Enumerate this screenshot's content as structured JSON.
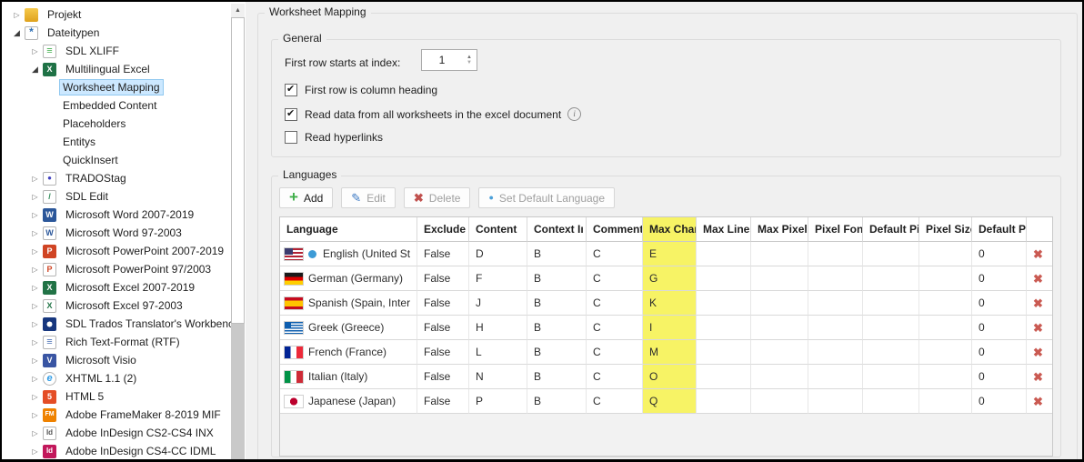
{
  "sidebar": {
    "items": [
      {
        "label": "Projekt",
        "level": 0,
        "arrow": "collapsed",
        "icon": "project",
        "icon_text": "",
        "selected": false
      },
      {
        "label": "Dateitypen",
        "level": 0,
        "arrow": "expanded",
        "icon": "filetypes",
        "icon_text": "*",
        "selected": false
      },
      {
        "label": "SDL XLIFF",
        "level": 1,
        "arrow": "collapsed",
        "icon": "sdlxliff",
        "icon_text": "≡",
        "selected": false
      },
      {
        "label": "Multilingual Excel",
        "level": 1,
        "arrow": "expanded",
        "icon": "mlexcel",
        "icon_text": "X",
        "selected": false
      },
      {
        "label": "Worksheet Mapping",
        "level": 2,
        "arrow": "none",
        "icon": null,
        "selected": true
      },
      {
        "label": "Embedded Content",
        "level": 2,
        "arrow": "none",
        "icon": null,
        "selected": false
      },
      {
        "label": "Placeholders",
        "level": 2,
        "arrow": "none",
        "icon": null,
        "selected": false
      },
      {
        "label": "Entitys",
        "level": 2,
        "arrow": "none",
        "icon": null,
        "selected": false
      },
      {
        "label": "QuickInsert",
        "level": 2,
        "arrow": "none",
        "icon": null,
        "selected": false
      },
      {
        "label": "TRADOStag",
        "level": 1,
        "arrow": "collapsed",
        "icon": "tradostag",
        "icon_text": "●",
        "selected": false
      },
      {
        "label": "SDL Edit",
        "level": 1,
        "arrow": "collapsed",
        "icon": "sdledit",
        "icon_text": "/",
        "selected": false
      },
      {
        "label": "Microsoft Word 2007-2019",
        "level": 1,
        "arrow": "collapsed",
        "icon": "word",
        "icon_text": "W",
        "selected": false
      },
      {
        "label": "Microsoft Word 97-2003",
        "level": 1,
        "arrow": "collapsed",
        "icon": "word97",
        "icon_text": "W",
        "selected": false
      },
      {
        "label": "Microsoft PowerPoint 2007-2019",
        "level": 1,
        "arrow": "collapsed",
        "icon": "ppt",
        "icon_text": "P",
        "selected": false
      },
      {
        "label": "Microsoft PowerPoint 97/2003",
        "level": 1,
        "arrow": "collapsed",
        "icon": "ppt97",
        "icon_text": "P",
        "selected": false
      },
      {
        "label": "Microsoft Excel 2007-2019",
        "level": 1,
        "arrow": "collapsed",
        "icon": "excel",
        "icon_text": "X",
        "selected": false
      },
      {
        "label": "Microsoft Excel 97-2003",
        "level": 1,
        "arrow": "collapsed",
        "icon": "excel97",
        "icon_text": "X",
        "selected": false
      },
      {
        "label": "SDL Trados Translator's Workbench",
        "level": 1,
        "arrow": "collapsed",
        "icon": "workbench",
        "icon_text": "",
        "selected": false
      },
      {
        "label": "Rich Text-Format (RTF)",
        "level": 1,
        "arrow": "collapsed",
        "icon": "rtf",
        "icon_text": "≡",
        "selected": false
      },
      {
        "label": "Microsoft Visio",
        "level": 1,
        "arrow": "collapsed",
        "icon": "visio",
        "icon_text": "V",
        "selected": false
      },
      {
        "label": "XHTML 1.1 (2)",
        "level": 1,
        "arrow": "collapsed",
        "icon": "xhtml",
        "icon_text": "e",
        "selected": false
      },
      {
        "label": "HTML 5",
        "level": 1,
        "arrow": "collapsed",
        "icon": "html5",
        "icon_text": "5",
        "selected": false
      },
      {
        "label": "Adobe FrameMaker 8-2019 MIF",
        "level": 1,
        "arrow": "collapsed",
        "icon": "framemaker",
        "icon_text": "FM",
        "selected": false
      },
      {
        "label": "Adobe InDesign CS2-CS4 INX",
        "level": 1,
        "arrow": "collapsed",
        "icon": "indesign_inx",
        "icon_text": "Id",
        "selected": false
      },
      {
        "label": "Adobe InDesign CS4-CC IDML",
        "level": 1,
        "arrow": "collapsed",
        "icon": "indesign_idml",
        "icon_text": "Id",
        "selected": false
      }
    ]
  },
  "page": {
    "group_label": "Worksheet Mapping"
  },
  "general": {
    "group_label": "General",
    "first_row_label": "First row starts at index:",
    "first_row_value": "1",
    "checkboxes": [
      {
        "label": "First row is column heading",
        "checked": true,
        "info": false
      },
      {
        "label": "Read data from all worksheets in the excel document",
        "checked": true,
        "info": true
      },
      {
        "label": "Read hyperlinks",
        "checked": false,
        "info": false
      }
    ]
  },
  "languages": {
    "group_label": "Languages",
    "toolbar": [
      {
        "label": "Add",
        "icon": "plus-icon",
        "glyph": "+",
        "enabled": true
      },
      {
        "label": "Edit",
        "icon": "pencil-icon",
        "glyph": "✎",
        "enabled": false
      },
      {
        "label": "Delete",
        "icon": "cross-icon",
        "glyph": "✖",
        "enabled": false
      },
      {
        "label": "Set Default Language",
        "icon": "dot-icon",
        "glyph": "●",
        "enabled": false
      }
    ],
    "table": {
      "columns": [
        "Language",
        "Exclude Ir",
        "Content",
        "Context Iı",
        "Comment",
        "Max Char",
        "Max Lines",
        "Max Pixel",
        "Pixel Font",
        "Default Pi",
        "Pixel Size",
        "Default Pi",
        ""
      ],
      "highlight_column_index": 5,
      "highlight_color": "#f7f365",
      "rows": [
        {
          "flag": "us",
          "is_default": true,
          "language": "English (United St",
          "exclude": "False",
          "content": "D",
          "context": "B",
          "comment": "C",
          "max_char": "E",
          "max_lines": "",
          "max_pixel": "",
          "pixel_font": "",
          "default_pixel_font": "",
          "pixel_size": "",
          "default_pixel_size": "0"
        },
        {
          "flag": "de",
          "is_default": false,
          "language": "German (Germany)",
          "exclude": "False",
          "content": "F",
          "context": "B",
          "comment": "C",
          "max_char": "G",
          "max_lines": "",
          "max_pixel": "",
          "pixel_font": "",
          "default_pixel_font": "",
          "pixel_size": "",
          "default_pixel_size": "0"
        },
        {
          "flag": "es",
          "is_default": false,
          "language": "Spanish (Spain, Inter",
          "exclude": "False",
          "content": "J",
          "context": "B",
          "comment": "C",
          "max_char": "K",
          "max_lines": "",
          "max_pixel": "",
          "pixel_font": "",
          "default_pixel_font": "",
          "pixel_size": "",
          "default_pixel_size": "0"
        },
        {
          "flag": "gr",
          "is_default": false,
          "language": "Greek (Greece)",
          "exclude": "False",
          "content": "H",
          "context": "B",
          "comment": "C",
          "max_char": "I",
          "max_lines": "",
          "max_pixel": "",
          "pixel_font": "",
          "default_pixel_font": "",
          "pixel_size": "",
          "default_pixel_size": "0"
        },
        {
          "flag": "fr",
          "is_default": false,
          "language": "French (France)",
          "exclude": "False",
          "content": "L",
          "context": "B",
          "comment": "C",
          "max_char": "M",
          "max_lines": "",
          "max_pixel": "",
          "pixel_font": "",
          "default_pixel_font": "",
          "pixel_size": "",
          "default_pixel_size": "0"
        },
        {
          "flag": "it",
          "is_default": false,
          "language": "Italian (Italy)",
          "exclude": "False",
          "content": "N",
          "context": "B",
          "comment": "C",
          "max_char": "O",
          "max_lines": "",
          "max_pixel": "",
          "pixel_font": "",
          "default_pixel_font": "",
          "pixel_size": "",
          "default_pixel_size": "0"
        },
        {
          "flag": "jp",
          "is_default": false,
          "language": "Japanese (Japan)",
          "exclude": "False",
          "content": "P",
          "context": "B",
          "comment": "C",
          "max_char": "Q",
          "max_lines": "",
          "max_pixel": "",
          "pixel_font": "",
          "default_pixel_font": "",
          "pixel_size": "",
          "default_pixel_size": "0"
        }
      ]
    }
  }
}
